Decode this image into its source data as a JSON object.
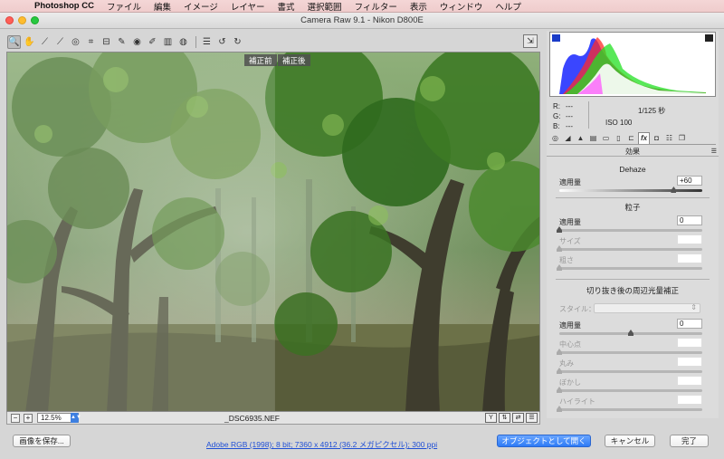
{
  "menubar": {
    "app": "Photoshop CC",
    "items": [
      "ファイル",
      "編集",
      "イメージ",
      "レイヤー",
      "書式",
      "選択範囲",
      "フィルター",
      "表示",
      "ウィンドウ",
      "ヘルプ"
    ]
  },
  "window": {
    "title": "Camera Raw 9.1  -  Nikon D800E"
  },
  "toolbar": {
    "tools": [
      {
        "name": "zoom-tool",
        "icon": "🔍"
      },
      {
        "name": "hand-tool",
        "icon": "✋"
      },
      {
        "name": "white-balance-tool",
        "icon": "⟋"
      },
      {
        "name": "color-sampler-tool",
        "icon": "⟋"
      },
      {
        "name": "targeted-adjustment-tool",
        "icon": "◎"
      },
      {
        "name": "crop-tool",
        "icon": "⌗"
      },
      {
        "name": "straighten-tool",
        "icon": "⊟"
      },
      {
        "name": "spot-removal-tool",
        "icon": "✎"
      },
      {
        "name": "red-eye-tool",
        "icon": "◉"
      },
      {
        "name": "adjustment-brush-tool",
        "icon": "✐"
      },
      {
        "name": "graduated-filter-tool",
        "icon": "▥"
      },
      {
        "name": "radial-filter-tool",
        "icon": "◍"
      },
      {
        "name": "preferences-icon",
        "icon": "☰"
      },
      {
        "name": "rotate-ccw-icon",
        "icon": "↺"
      },
      {
        "name": "rotate-cw-icon",
        "icon": "↻"
      }
    ],
    "fullscreen_icon": "⇲"
  },
  "preview": {
    "label_before": "補正前",
    "label_after": "補正後",
    "zoom": "12.5%",
    "filename": "_DSC6935.NEF",
    "zoom_minus": "−",
    "zoom_plus": "+"
  },
  "info": {
    "r_label": "R:",
    "r_value": "---",
    "g_label": "G:",
    "g_value": "---",
    "b_label": "B:",
    "b_value": "---",
    "shutter": "1/125 秒",
    "iso": "ISO 100"
  },
  "panel": {
    "title": "効果",
    "dehaze": {
      "title": "Dehaze",
      "amount_label": "適用量",
      "amount": "+60",
      "amount_value": 60
    },
    "grain": {
      "title": "粒子",
      "rows": [
        {
          "label": "適用量",
          "value": "0"
        },
        {
          "label": "サイズ",
          "value": ""
        },
        {
          "label": "粗さ",
          "value": ""
        }
      ]
    },
    "vignette": {
      "title": "切り抜き後の周辺光量補正",
      "style_label": "スタイル：",
      "rows": [
        {
          "label": "適用量",
          "value": "0"
        },
        {
          "label": "中心点",
          "value": ""
        },
        {
          "label": "丸み",
          "value": ""
        },
        {
          "label": "ぼかし",
          "value": ""
        },
        {
          "label": "ハイライト",
          "value": ""
        }
      ]
    }
  },
  "bottom": {
    "save": "画像を保存...",
    "workflow": "Adobe RGB (1998); 8 bit; 7360 x 4912 (36.2 メガピクセル); 300 ppi",
    "open_object": "オブジェクトとして開く",
    "cancel": "キャンセル",
    "done": "完了"
  },
  "colors": {
    "accent": "#2e7bf6",
    "link": "#1f4fd6"
  }
}
